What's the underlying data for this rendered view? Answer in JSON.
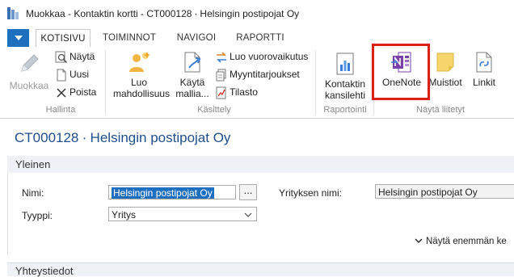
{
  "window": {
    "title": "Muokkaa - Kontaktin kortti - CT000128 ∙ Helsingin postipojat Oy"
  },
  "ribbon": {
    "tabs": [
      {
        "label": "KOTISIVU",
        "active": true
      },
      {
        "label": "TOIMINNOT",
        "active": false
      },
      {
        "label": "NAVIGOI",
        "active": false
      },
      {
        "label": "RAPORTTI",
        "active": false
      }
    ],
    "groups": {
      "hallinta": {
        "label": "Hallinta",
        "edit_label": "Muokkaa",
        "view_label": "Näytä",
        "new_label": "Uusi",
        "delete_label": "Poista"
      },
      "kasittely": {
        "label": "Käsittely",
        "create_opportunity_label": "Luo mahdollisuus",
        "use_template_label": "Käytä mallia...",
        "create_interaction_label": "Luo vuorovaikutus",
        "sales_quotes_label": "Myyntitarjoukset",
        "statistics_label": "Tilasto"
      },
      "raportointi": {
        "label": "Raportointi",
        "contact_sheet_label": "Kontaktin kansilehti"
      },
      "nayta_liitetyt": {
        "label": "Näytä liitetyt",
        "onenote_label": "OneNote",
        "notes_label": "Muistiot",
        "links_label": "Linkit"
      }
    }
  },
  "page": {
    "title": "CT000128 ∙ Helsingin postipojat Oy",
    "general_tab": {
      "header": "Yleinen",
      "name_label": "Nimi:",
      "name_value": "Helsingin postipojat Oy",
      "assist_label": "...",
      "type_label": "Tyyppi:",
      "type_value": "Yritys",
      "company_name_label": "Yrityksen nimi:",
      "company_name_value": "Helsingin postipojat Oy",
      "show_more_label": "Näytä enemmän ke"
    },
    "communication_tab": {
      "header": "Yhteystiedot"
    }
  },
  "colors": {
    "accent": "#1f6fc1",
    "highlight_box": "#e01d1d",
    "title_blue": "#1f4e8c"
  }
}
